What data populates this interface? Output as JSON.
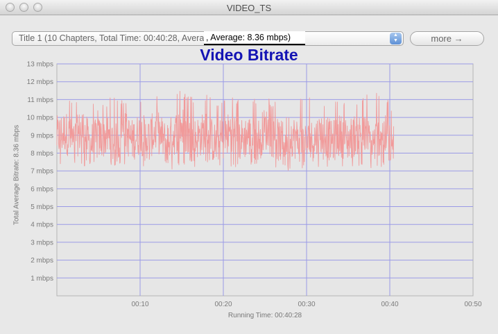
{
  "window": {
    "title": "VIDEO_TS"
  },
  "title_select": {
    "value": "Title 1 (10 Chapters, Total Time: 00:40:28, Average: 8.36 mbps)",
    "stepper_up": "▲",
    "stepper_down": "▼"
  },
  "average_overlay": {
    "text": ", Average: 8.36 mbps)"
  },
  "more_button": {
    "label": "more →"
  },
  "colors": {
    "series": "#f19a9a",
    "grid": "#9a9ae6",
    "plot_background": "#e6e6e6",
    "title": "#1414b4"
  },
  "chart_data": {
    "type": "line",
    "title": "Video Bitrate",
    "ylabel": "Total Average Bitrate: 8.36 mbps",
    "xlabel": "Running Time: 00:40:28",
    "ylim": [
      0,
      13
    ],
    "xlim_minutes": [
      0,
      50
    ],
    "y_ticks": [
      "1 mbps",
      "2 mbps",
      "3 mbps",
      "4 mbps",
      "5 mbps",
      "6 mbps",
      "7 mbps",
      "8 mbps",
      "9 mbps",
      "10 mbps",
      "11 mbps",
      "12 mbps",
      "13 mbps"
    ],
    "x_ticks": [
      "00:10",
      "00:20",
      "00:30",
      "00:40",
      "00:50"
    ],
    "grid": true,
    "series": [
      {
        "x_minutes": [
          0,
          1,
          2,
          3,
          4,
          5,
          6,
          7,
          8,
          9,
          10,
          11,
          12,
          13,
          14,
          15,
          16,
          17,
          18,
          19,
          20,
          21,
          22,
          23,
          24,
          25,
          26,
          27,
          28,
          29,
          30,
          31,
          32,
          33,
          34,
          35,
          36,
          37,
          38,
          39,
          40,
          40.47
        ],
        "values": [
          8.9,
          9.2,
          8.6,
          9.4,
          8.5,
          8.8,
          9.0,
          8.4,
          9.3,
          8.7,
          9.1,
          8.8,
          9.3,
          8.6,
          9.0,
          9.5,
          8.7,
          8.9,
          9.2,
          8.5,
          8.8,
          9.3,
          8.7,
          9.0,
          8.6,
          9.4,
          8.9,
          8.6,
          9.1,
          8.7,
          8.5,
          8.8,
          9.2,
          8.6,
          9.0,
          8.7,
          9.1,
          8.9,
          8.5,
          9.2,
          8.6,
          8.4
        ],
        "min_values": [
          7.3,
          7.1,
          7.4,
          7.2,
          7.3,
          7.0,
          6.6,
          7.3,
          7.4,
          7.2,
          7.1,
          7.4,
          7.2,
          7.3,
          7.0,
          7.2,
          7.4,
          7.1,
          7.3,
          7.2,
          7.4,
          7.1,
          7.3,
          7.2,
          7.4,
          7.3,
          7.1,
          7.2,
          6.9,
          6.6,
          7.4,
          7.2,
          7.3,
          7.1,
          7.4,
          7.0,
          7.3,
          7.1,
          6.8,
          7.2,
          7.3,
          7.4
        ],
        "max_values": [
          10.8,
          11.3,
          11.0,
          10.9,
          11.1,
          10.6,
          11.0,
          11.4,
          10.9,
          10.8,
          11.0,
          11.1,
          11.3,
          10.8,
          11.4,
          11.6,
          11.2,
          11.0,
          11.3,
          10.9,
          11.1,
          11.5,
          10.9,
          11.2,
          11.0,
          11.3,
          10.8,
          11.4,
          11.1,
          11.2,
          11.0,
          11.3,
          10.9,
          11.1,
          11.2,
          10.8,
          11.1,
          11.2,
          11.6,
          11.5,
          10.9,
          10.2
        ]
      }
    ]
  }
}
